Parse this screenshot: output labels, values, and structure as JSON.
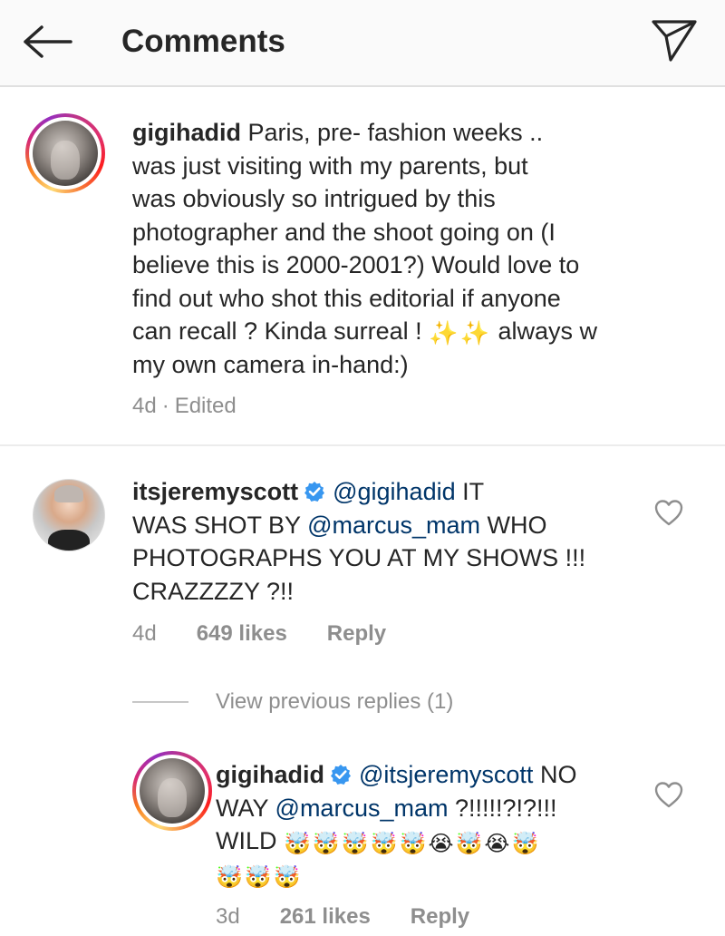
{
  "header": {
    "title": "Comments",
    "back_icon": "arrow-left-icon",
    "share_icon": "paper-plane-icon"
  },
  "caption": {
    "username": "gigihadid",
    "lines": [
      "Paris, pre- fashion weeks ..",
      "was just visiting with my parents, but",
      "was obviously so intrigued by this",
      "photographer and the shoot going on (I",
      "believe this is 2000-2001?) Would love to",
      "find out who shot this editorial if anyone",
      "can recall ? Kinda surreal !",
      "always w",
      "my own camera in-hand:)"
    ],
    "emojis": [
      "✨",
      "✨"
    ],
    "time": "4d",
    "separator": "·",
    "edited": "Edited"
  },
  "comment": {
    "username": "itsjeremyscott",
    "verified_icon": "verified-badge-icon",
    "mention": "@gigihadid",
    "line1_tail": "IT",
    "line2_text": "WAS SHOT BY",
    "line2_mention": "@marcus_mam",
    "line2_tail": "WHO",
    "line3": "PHOTOGRAPHS YOU AT MY SHOWS !!!",
    "line4": "CRAZZZZY ?!!",
    "time": "4d",
    "likes": "649 likes",
    "reply": "Reply"
  },
  "view_previous_replies": "View previous replies (1)",
  "reply": {
    "username": "gigihadid",
    "verified_icon": "verified-badge-icon",
    "mention": "@itsjeremyscott",
    "line1_tail": "NO",
    "line2_text": "WAY",
    "line2_mention": "@marcus_mam",
    "line2_tail": "?!!!!!?!?!!!",
    "line3_text": "WILD",
    "emoji_line3": [
      "🤯",
      "🤯",
      "🤯",
      "🤯",
      "🤯",
      "😭",
      "🤯",
      "😭",
      "🤯"
    ],
    "emoji_line4": [
      "🤯",
      "🤯",
      "🤯"
    ],
    "time": "3d",
    "likes": "261 likes",
    "reply": "Reply"
  },
  "colors": {
    "text": "#262626",
    "secondary": "#8e8e8e",
    "verified": "#3897f0",
    "mention": "#003569"
  }
}
